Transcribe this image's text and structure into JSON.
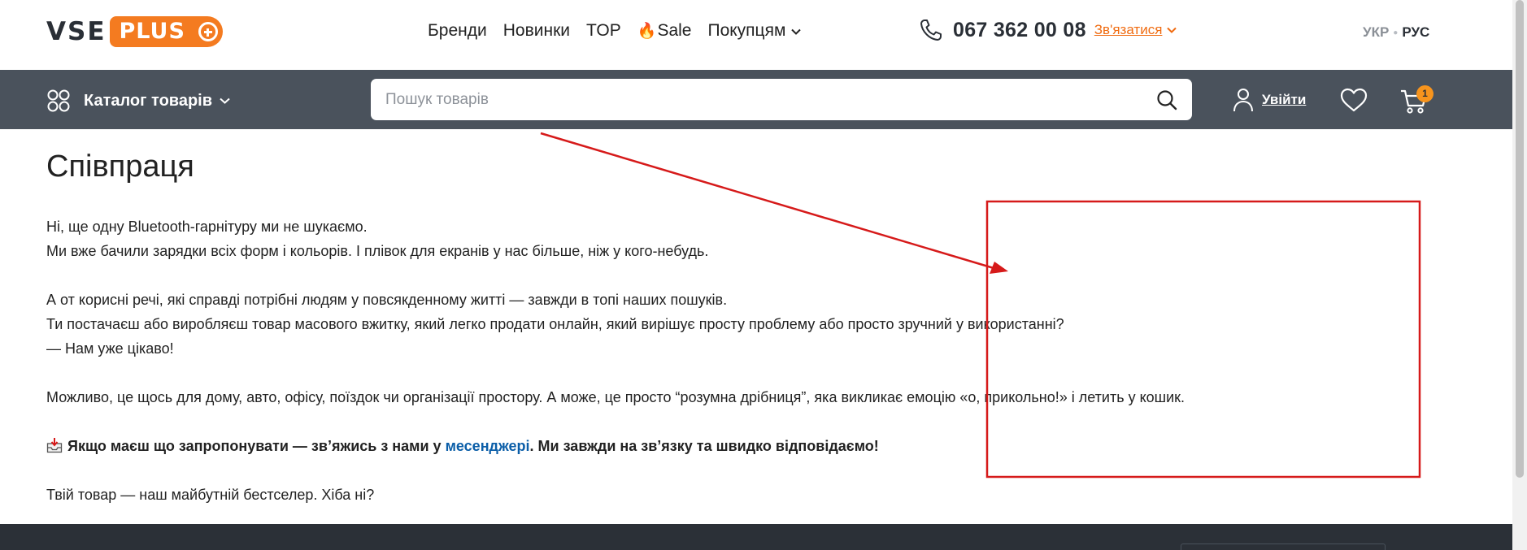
{
  "header": {
    "logo": {
      "vse": "VSE",
      "plus": "PLUS"
    },
    "nav": [
      {
        "label": "Бренди",
        "icon": null,
        "dropdown": false
      },
      {
        "label": "Новинки",
        "icon": null,
        "dropdown": false
      },
      {
        "label": "TOP",
        "icon": null,
        "dropdown": false
      },
      {
        "label": "Sale",
        "icon": "fire-icon",
        "dropdown": false
      },
      {
        "label": "Покупцям",
        "icon": null,
        "dropdown": true
      }
    ],
    "phone": "067 362 00 08",
    "contact_label": "Зв'язатися",
    "languages": {
      "ua": "УКР",
      "ru": "РУС"
    }
  },
  "toolbar": {
    "catalog_label": "Каталог товарів",
    "search_placeholder": "Пошук товарів",
    "login_label": "Увійти",
    "cart_count": "1"
  },
  "page": {
    "title": "Співпраця",
    "paragraphs": {
      "p1": "Ні, ще одну Bluetooth-гарнітуру ми не шукаємо.",
      "p2": "Ми вже бачили зарядки всіх форм і кольорів. І плівок для екранів у нас більше, ніж у кого-небудь.",
      "p3": "А от корисні речі, які справді потрібні людям у повсякденному житті — завжди в топі наших пошуків.",
      "p4": "Ти постачаєш або виробляєш товар масового вжитку, який легко продати онлайн, який вирішує просту проблему або просто зручний у використанні?",
      "p5": "— Нам уже цікаво!",
      "p6": "Можливо, це щось для дому, авто, офісу, поїздок чи організації простору. А може, це просто “розумна дрібниця”, яка викликає емоцію «о, прикольно!» і летить у кошик.",
      "cta_before": "Якщо маєш що запропонувати — зв’яжись з нами у ",
      "cta_link": "месенджері",
      "cta_after": ". Ми завжди на зв’язку та швидко відповідаємо!",
      "p8": "Твій товар — наш майбутній бестселер. Хіба ні?"
    }
  },
  "colors": {
    "brand_orange": "#f47b20",
    "dark_bar": "#4a525c",
    "link_blue": "#0b5ea8",
    "annotation_red": "#d61a1a"
  }
}
